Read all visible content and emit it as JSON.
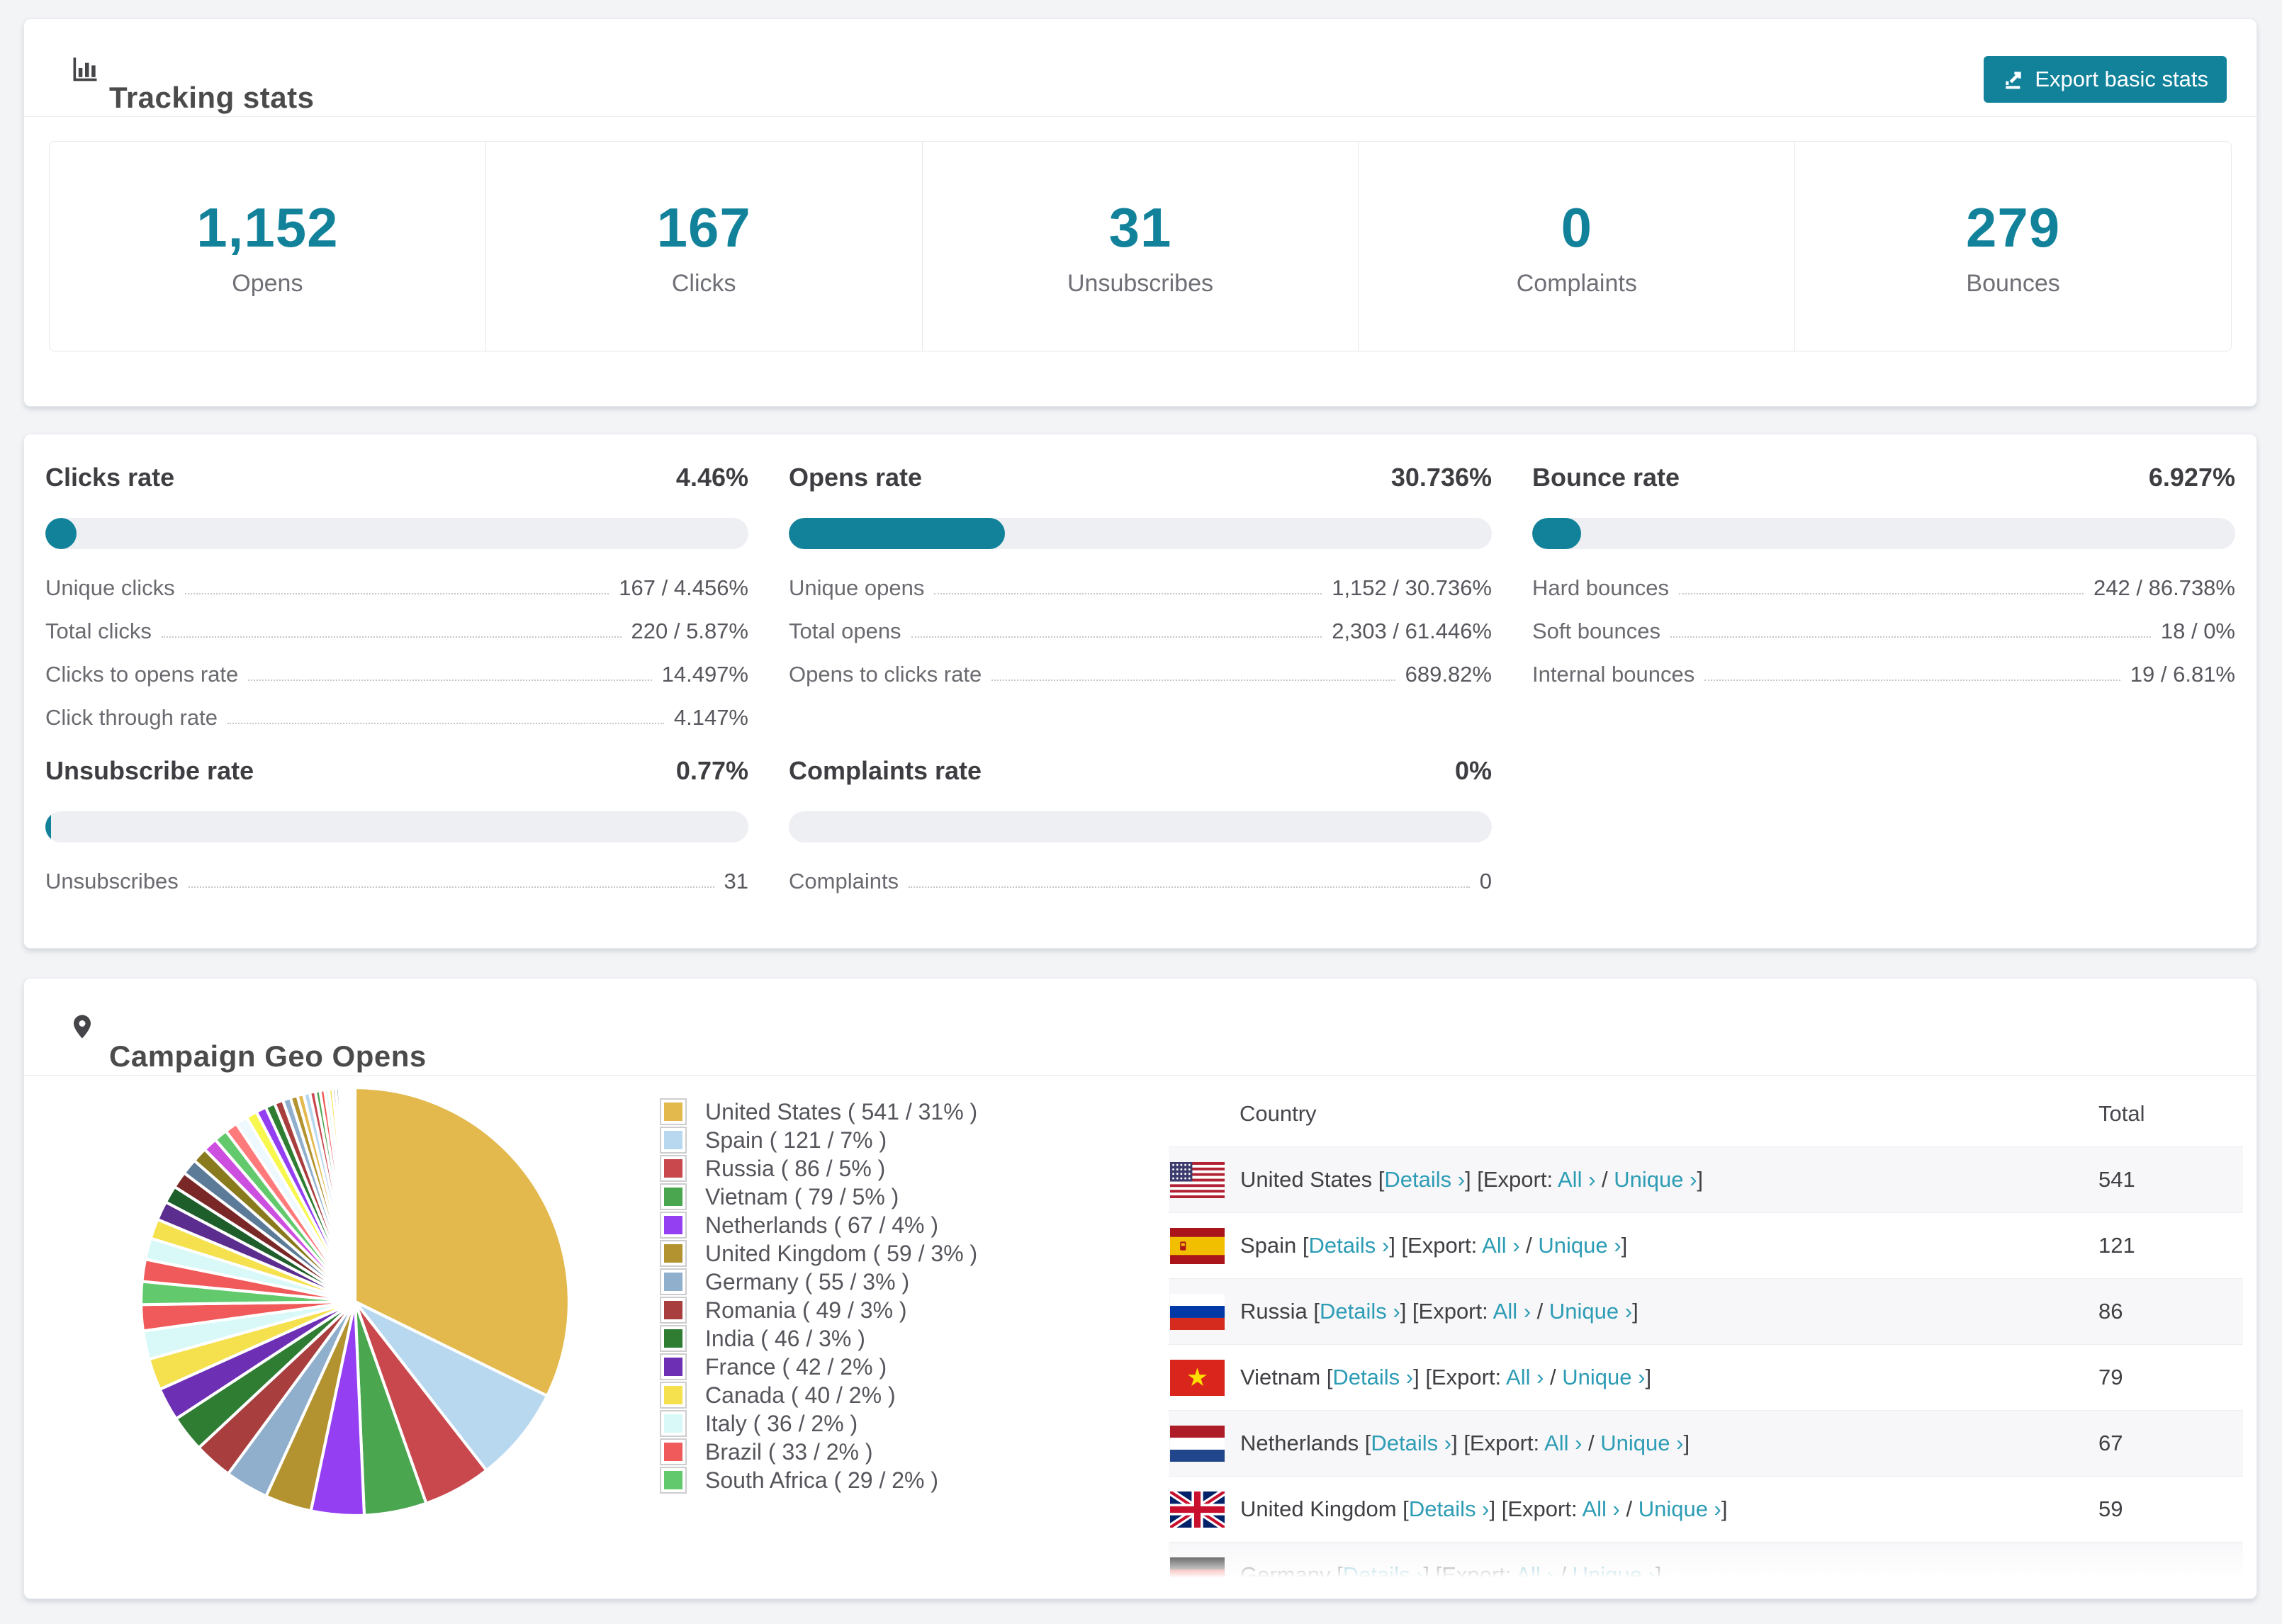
{
  "accent_color": "#12829b",
  "link_color": "#2d9cb5",
  "header": {
    "title": "Tracking stats",
    "export_label": "Export basic stats"
  },
  "stats": [
    {
      "value": "1,152",
      "label": "Opens"
    },
    {
      "value": "167",
      "label": "Clicks"
    },
    {
      "value": "31",
      "label": "Unsubscribes"
    },
    {
      "value": "0",
      "label": "Complaints"
    },
    {
      "value": "279",
      "label": "Bounces"
    }
  ],
  "rates": {
    "clicks": {
      "title": "Clicks rate",
      "value": "4.46%",
      "fill_pct": 4.46,
      "rows": [
        {
          "label": "Unique clicks",
          "value": "167 / 4.456%"
        },
        {
          "label": "Total clicks",
          "value": "220 / 5.87%"
        },
        {
          "label": "Clicks to opens rate",
          "value": "14.497%"
        },
        {
          "label": "Click through rate",
          "value": "4.147%"
        }
      ]
    },
    "opens": {
      "title": "Opens rate",
      "value": "30.736%",
      "fill_pct": 30.736,
      "rows": [
        {
          "label": "Unique opens",
          "value": "1,152 / 30.736%"
        },
        {
          "label": "Total opens",
          "value": "2,303 / 61.446%"
        },
        {
          "label": "Opens to clicks rate",
          "value": "689.82%"
        }
      ]
    },
    "bounce": {
      "title": "Bounce rate",
      "value": "6.927%",
      "fill_pct": 6.927,
      "rows": [
        {
          "label": "Hard bounces",
          "value": "242 / 86.738%"
        },
        {
          "label": "Soft bounces",
          "value": "18 / 0%"
        },
        {
          "label": "Internal bounces",
          "value": "19 / 6.81%"
        }
      ]
    },
    "unsubscribe": {
      "title": "Unsubscribe rate",
      "value": "0.77%",
      "fill_pct": 0.77,
      "rows": [
        {
          "label": "Unsubscribes",
          "value": "31"
        }
      ]
    },
    "complaints": {
      "title": "Complaints rate",
      "value": "0%",
      "fill_pct": 0,
      "rows": [
        {
          "label": "Complaints",
          "value": "0"
        }
      ]
    }
  },
  "geo": {
    "title": "Campaign Geo Opens",
    "table": {
      "headers": {
        "country": "Country",
        "total": "Total"
      },
      "link_labels": {
        "details": "Details ›",
        "export": "Export:",
        "all": "All ›",
        "unique": "Unique ›"
      },
      "rows": [
        {
          "flag": "us",
          "country": "United States",
          "total": "541"
        },
        {
          "flag": "es",
          "country": "Spain",
          "total": "121"
        },
        {
          "flag": "ru",
          "country": "Russia",
          "total": "86"
        },
        {
          "flag": "vn",
          "country": "Vietnam",
          "total": "79"
        },
        {
          "flag": "nl",
          "country": "Netherlands",
          "total": "67"
        },
        {
          "flag": "gb",
          "country": "United Kingdom",
          "total": "59"
        },
        {
          "flag": "de",
          "country": "Germany",
          "total": ""
        }
      ]
    }
  },
  "chart_data": {
    "type": "pie",
    "title": "Campaign Geo Opens",
    "legend_position": "right-of-pie",
    "series": [
      {
        "label": "United States",
        "value": 541,
        "pct": "31%",
        "color": "#e3b94d"
      },
      {
        "label": "Spain",
        "value": 121,
        "pct": "7%",
        "color": "#b8d8f0"
      },
      {
        "label": "Russia",
        "value": 86,
        "pct": "5%",
        "color": "#c9484d"
      },
      {
        "label": "Vietnam",
        "value": 79,
        "pct": "5%",
        "color": "#4aa64f"
      },
      {
        "label": "Netherlands",
        "value": 67,
        "pct": "4%",
        "color": "#9440f2"
      },
      {
        "label": "United Kingdom",
        "value": 59,
        "pct": "3%",
        "color": "#b3932f"
      },
      {
        "label": "Germany",
        "value": 55,
        "pct": "3%",
        "color": "#8fafcc"
      },
      {
        "label": "Romania",
        "value": 49,
        "pct": "3%",
        "color": "#a83e3e"
      },
      {
        "label": "India",
        "value": 46,
        "pct": "3%",
        "color": "#2e7d32"
      },
      {
        "label": "France",
        "value": 42,
        "pct": "2%",
        "color": "#6d2fb4"
      },
      {
        "label": "Canada",
        "value": 40,
        "pct": "2%",
        "color": "#f5e04d"
      },
      {
        "label": "Italy",
        "value": 36,
        "pct": "2%",
        "color": "#d9f8f8"
      },
      {
        "label": "Brazil",
        "value": 33,
        "pct": "2%",
        "color": "#f05a5a"
      },
      {
        "label": "South Africa",
        "value": 29,
        "pct": "2%",
        "color": "#62c96c"
      }
    ],
    "others_unlabeled": [
      28,
      27,
      25,
      24,
      22,
      21,
      20,
      19,
      18,
      17,
      16,
      15,
      14,
      13,
      12,
      11,
      10,
      9,
      8,
      8,
      7,
      6,
      6,
      5,
      5,
      4,
      4,
      3,
      3,
      2,
      2,
      2,
      1,
      1,
      1,
      1,
      1,
      1,
      1,
      1
    ],
    "others_palette": [
      "#f05a5a",
      "#d9f8f8",
      "#f5e04d",
      "#5b2d8f",
      "#1d5e2a",
      "#7a2727",
      "#5c7b99",
      "#8a7a1e",
      "#cc4fe0",
      "#62c96c",
      "#ff7b7b",
      "#eef9ff",
      "#f7f74d",
      "#9440f2",
      "#2e7d32",
      "#a83e3e",
      "#8fafcc",
      "#b3932f",
      "#e3b94d",
      "#b8d8f0",
      "#c9484d",
      "#4aa64f"
    ]
  }
}
